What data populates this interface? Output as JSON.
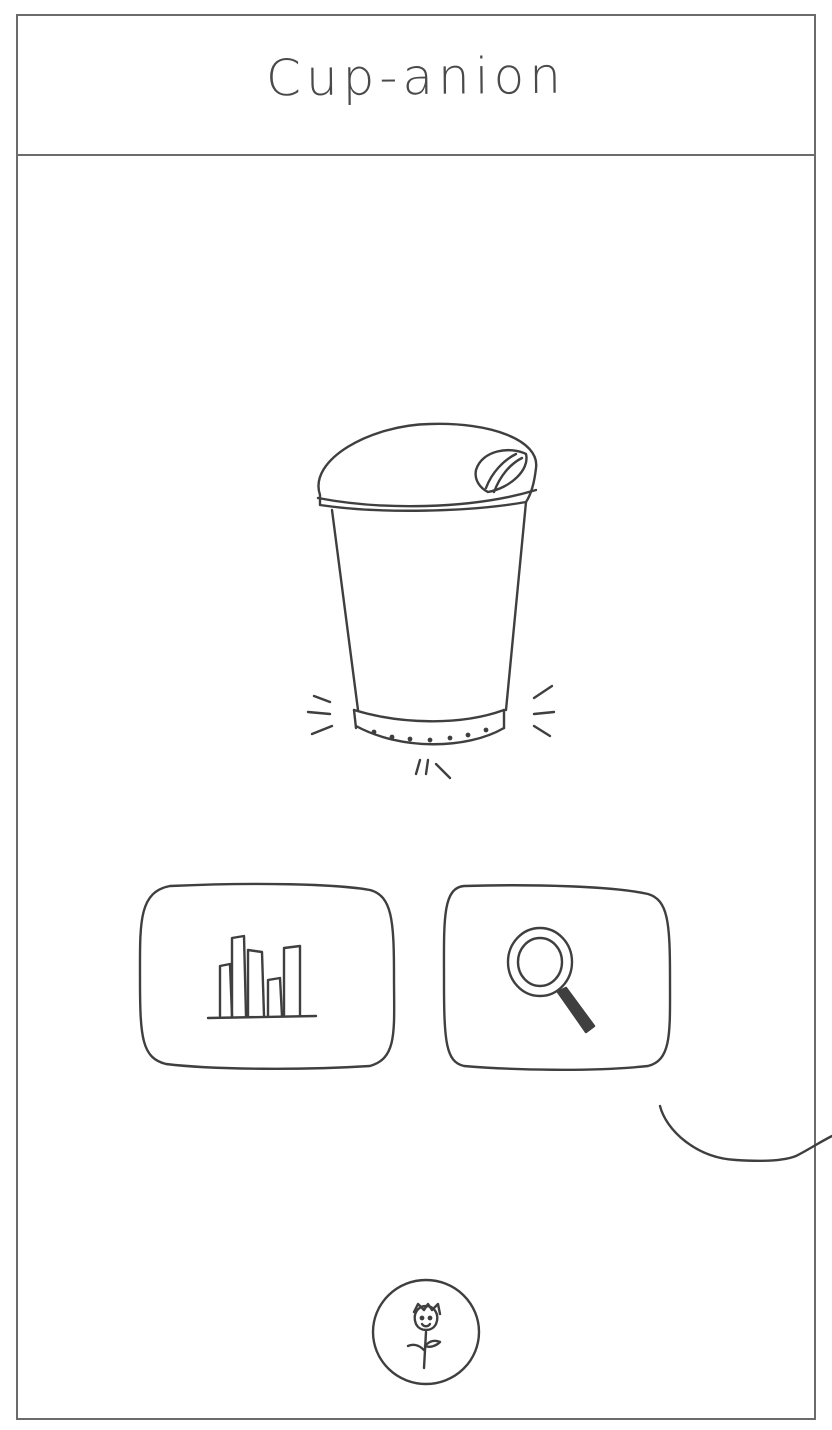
{
  "app": {
    "title": "Cup-anion"
  },
  "main": {
    "hero_icon": "smart-cup-icon",
    "tiles": [
      {
        "icon": "bar-chart-icon"
      },
      {
        "icon": "magnifying-glass-icon"
      }
    ]
  },
  "footer": {
    "profile_icon": "flower-avatar-icon"
  },
  "colors": {
    "stroke": "#3f3f3f",
    "frame": "#6b6b6b",
    "background": "#ffffff"
  }
}
